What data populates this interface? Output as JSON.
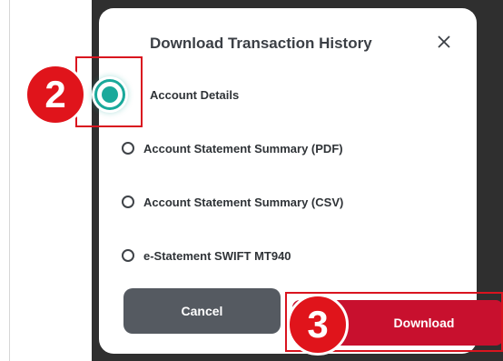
{
  "dialog": {
    "title": "Download Transaction History",
    "close_icon": "close-icon",
    "options": [
      {
        "label": "Account Details",
        "selected": true
      },
      {
        "label": "Account Statement Summary (PDF)",
        "selected": false
      },
      {
        "label": "Account Statement Summary (CSV)",
        "selected": false
      },
      {
        "label": "e-Statement SWIFT MT940",
        "selected": false
      }
    ],
    "cancel_label": "Cancel",
    "download_label": "Download"
  },
  "annotations": {
    "step_2": "2",
    "step_3": "3"
  },
  "colors": {
    "accent_teal": "#1aa99b",
    "primary_red": "#c8102e",
    "cancel_gray": "#555a61",
    "annotation_red": "#e0141b"
  }
}
